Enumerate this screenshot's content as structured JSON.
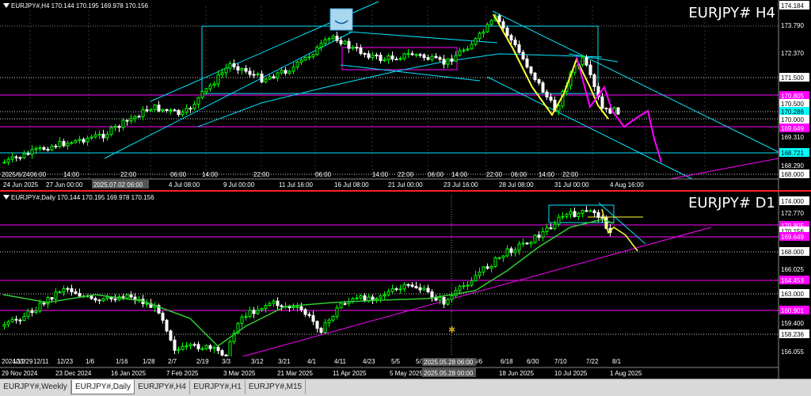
{
  "h4": {
    "ohlc_label": "EURJPY#,H4  170.144 170.195 169.978 170.156",
    "big_label": "EURJPY# H4",
    "price_labels": [
      {
        "text": "174.184",
        "bg": "#ffffff",
        "fg": "#000000"
      },
      {
        "text": "173.790",
        "bg": "",
        "fg": "#ffffff"
      },
      {
        "text": "172.370",
        "bg": "",
        "fg": "#ffffff"
      },
      {
        "text": "171.500",
        "bg": "#ffffff",
        "fg": "#000000"
      },
      {
        "text": "170.805",
        "bg": "#ff00ff",
        "fg": "#ffffff"
      },
      {
        "text": "170.500",
        "bg": "#ffffff",
        "fg": "#000000"
      },
      {
        "text": "170.286",
        "bg": "#00ffff",
        "fg": "#000000"
      },
      {
        "text": "170.000",
        "bg": "#ffffff",
        "fg": "#000000"
      },
      {
        "text": "169.649",
        "bg": "#ff00ff",
        "fg": "#ffffff"
      },
      {
        "text": "169.310",
        "bg": "",
        "fg": "#ffffff"
      },
      {
        "text": "168.721",
        "bg": "#00ffff",
        "fg": "#000000"
      },
      {
        "text": "168.290",
        "bg": "",
        "fg": "#ffffff"
      },
      {
        "text": "168.000",
        "bg": "#ffffff",
        "fg": "#000000"
      }
    ],
    "time_labels": [
      "24 Jun 2025",
      "27 Jun 00:00",
      "2025.07.02 06:00",
      "4 Jul 08:00",
      "9 Jul 00:00",
      "11 Jul 16:00",
      "16 Jul 08:00",
      "21 Jul 00:00",
      "23 Jul 16:00",
      "28 Jul 08:00",
      "31 Jul 00:00",
      "4 Aug 16:00"
    ],
    "time_hours": [
      "06:00",
      "14:00",
      "22:00",
      "06:00",
      "14:00",
      "22:00",
      "06:00",
      "14:00",
      "22:00",
      "06:00",
      "14:00",
      "22:00",
      "06:00",
      "14:00",
      "22:00"
    ],
    "cursor_date": "2025.07.02 06:00",
    "corner_date": "2025/6/24"
  },
  "d1": {
    "ohlc_label": "EURJPY#,Daily  170.144 170.195 169.978 170.156",
    "big_label": "EURJPY# D1",
    "price_labels": [
      {
        "text": "174.000",
        "bg": "#ffffff",
        "fg": "#000000"
      },
      {
        "text": "172.770",
        "bg": "",
        "fg": "#ffffff"
      },
      {
        "text": "170.805",
        "bg": "#ff00ff",
        "fg": "#ffffff"
      },
      {
        "text": "170.156",
        "bg": "#ffffff",
        "fg": "#000000"
      },
      {
        "text": "169.649",
        "bg": "#ff00ff",
        "fg": "#ffffff"
      },
      {
        "text": "168.000",
        "bg": "#ffffff",
        "fg": "#000000"
      },
      {
        "text": "166.025",
        "bg": "",
        "fg": "#ffffff"
      },
      {
        "text": "164.453",
        "bg": "#ff00ff",
        "fg": "#ffffff"
      },
      {
        "text": "163.000",
        "bg": "#ffffff",
        "fg": "#000000"
      },
      {
        "text": "160.901",
        "bg": "#ff00ff",
        "fg": "#ffffff"
      },
      {
        "text": "159.400",
        "bg": "",
        "fg": "#ffffff"
      },
      {
        "text": "158.236",
        "bg": "#ffffff",
        "fg": "#000000"
      },
      {
        "text": "156.055",
        "bg": "",
        "fg": "#ffffff"
      }
    ],
    "date_labels": [
      "12/2",
      "12/11",
      "12/23",
      "1/6",
      "1/16",
      "1/28",
      "2/7",
      "2/19",
      "3/3",
      "3/12",
      "3/21",
      "4/1",
      "4/11",
      "4/23",
      "5/5",
      "5/15",
      "5/28",
      "6/6",
      "6/18",
      "6/30",
      "7/10",
      "7/22",
      "8/1"
    ],
    "time_labels": [
      "29 Nov 2024",
      "23 Dec 2024",
      "16 Jan 2025",
      "7 Feb 2025",
      "3 Mar 2025",
      "21 Mar 2025",
      "11 Apr 2025",
      "5 May 2025",
      "2025.05.28 00:00",
      "18 Jun 2025",
      "10 Jul 2025",
      "1 Aug 2025"
    ],
    "cursor_date": "2025.05.28 06:00",
    "corner_date": "2024/11/29"
  },
  "tabs": [
    {
      "label": "EURJPY#,Weekly",
      "active": false
    },
    {
      "label": "EURJPY#,Daily",
      "active": true
    },
    {
      "label": "EURJPY#,H4",
      "active": false
    },
    {
      "label": "EURJPY#,H1",
      "active": false
    },
    {
      "label": "EURJPY#,M15",
      "active": false
    }
  ],
  "colors": {
    "bull": "#00ff00",
    "bear": "#ffffff",
    "trend_cyan": "#00e5ff",
    "level_magenta": "#ff00ff",
    "forecast_yellow": "#ffff33",
    "ma_green": "#33cc33"
  }
}
